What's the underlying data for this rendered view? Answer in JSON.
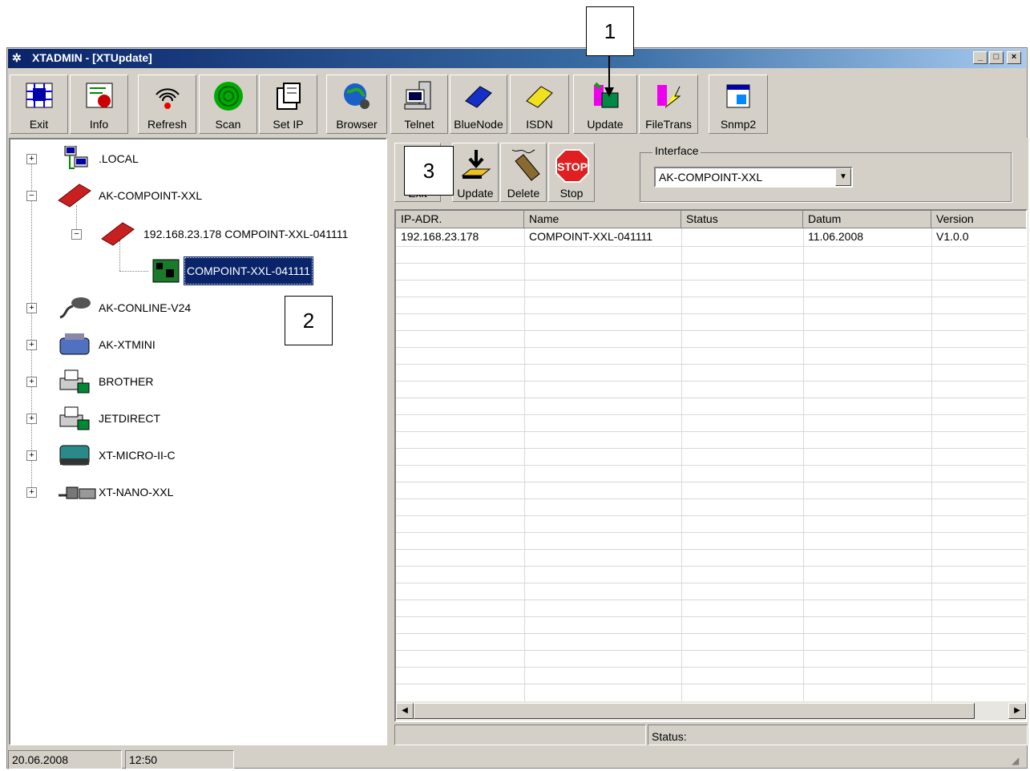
{
  "window": {
    "title": "XTADMIN - [XTUpdate]"
  },
  "toolbar": [
    {
      "label": "Exit",
      "icon": "exit-icon"
    },
    {
      "label": "Info",
      "icon": "info-icon"
    },
    {
      "label": "Refresh",
      "icon": "refresh-icon"
    },
    {
      "label": "Scan",
      "icon": "scan-icon"
    },
    {
      "label": "Set IP",
      "icon": "set-ip-icon"
    },
    {
      "label": "Browser",
      "icon": "browser-icon"
    },
    {
      "label": "Telnet",
      "icon": "telnet-icon"
    },
    {
      "label": "BlueNode",
      "icon": "bluenode-icon"
    },
    {
      "label": "ISDN",
      "icon": "isdn-icon"
    },
    {
      "label": "Update",
      "icon": "update-icon"
    },
    {
      "label": "FileTrans",
      "icon": "filetrans-icon"
    },
    {
      "label": "Snmp2",
      "icon": "snmp2-icon"
    }
  ],
  "tree": [
    {
      "label": ".LOCAL",
      "expander": "+"
    },
    {
      "label": "AK-COMPOINT-XXL",
      "expander": "−"
    },
    {
      "label": "192.168.23.178  COMPOINT-XXL-041111",
      "expander": "−"
    },
    {
      "label": "COMPOINT-XXL-041111",
      "selected": true
    },
    {
      "label": "AK-CONLINE-V24",
      "expander": "+"
    },
    {
      "label": "AK-XTMINI",
      "expander": "+"
    },
    {
      "label": "BROTHER",
      "expander": "+"
    },
    {
      "label": "JETDIRECT",
      "expander": "+"
    },
    {
      "label": "XT-MICRO-II-C",
      "expander": "+"
    },
    {
      "label": "XT-NANO-XXL",
      "expander": "+"
    }
  ],
  "right_toolbar": {
    "exit_label": "Exit",
    "update_label": "Update",
    "delete_label": "Delete",
    "stop_label": "Stop",
    "stop_sign": "STOP",
    "interface_label": "Interface",
    "interface_value": "AK-COMPOINT-XXL"
  },
  "table": {
    "columns": [
      "IP-ADR.",
      "Name",
      "Status",
      "Datum",
      "Version"
    ],
    "rows": [
      [
        "192.168.23.178",
        "COMPOINT-XXL-041111",
        "",
        "11.06.2008",
        "V1.0.0"
      ]
    ]
  },
  "status": {
    "label": "Status:",
    "date": "20.06.2008",
    "time": "12:50"
  },
  "callouts": [
    "1",
    "2",
    "3"
  ],
  "colors": {
    "title_start": "#0a246a",
    "title_end": "#a6caf0",
    "selection": "#0a246a",
    "face": "#d4d0c8"
  }
}
